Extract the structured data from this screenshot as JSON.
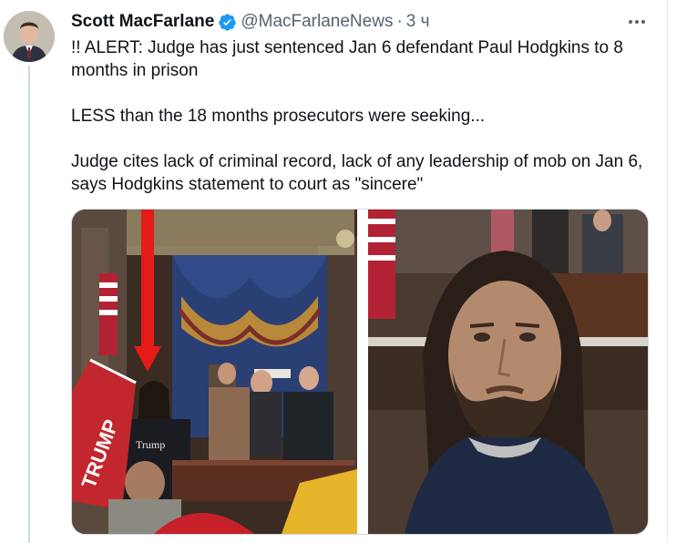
{
  "tweet": {
    "author_name": "Scott MacFarlane",
    "handle": "@MacFarlaneNews",
    "separator": "·",
    "time": "3 ч",
    "paragraphs": [
      "!!  ALERT:  Judge has just sentenced Jan 6 defendant Paul Hodgkins to 8 months in prison",
      "LESS than the 18 months prosecutors were seeking...",
      "Judge cites lack of criminal record, lack of any leadership of mob on Jan 6, says Hodgkins statement to court as \"sincere\""
    ]
  },
  "media": {
    "left_photo": {
      "flag_text": "TRUMP",
      "shirt_text": "Trump",
      "arrow_color": "#e41b17"
    },
    "right_photo": {}
  },
  "colors": {
    "verified": "#1d9bf0",
    "secondary_text": "#536471",
    "divider": "#cfd9de"
  },
  "icons": {
    "verified": "verified-badge-icon",
    "more": "more-options-icon"
  }
}
